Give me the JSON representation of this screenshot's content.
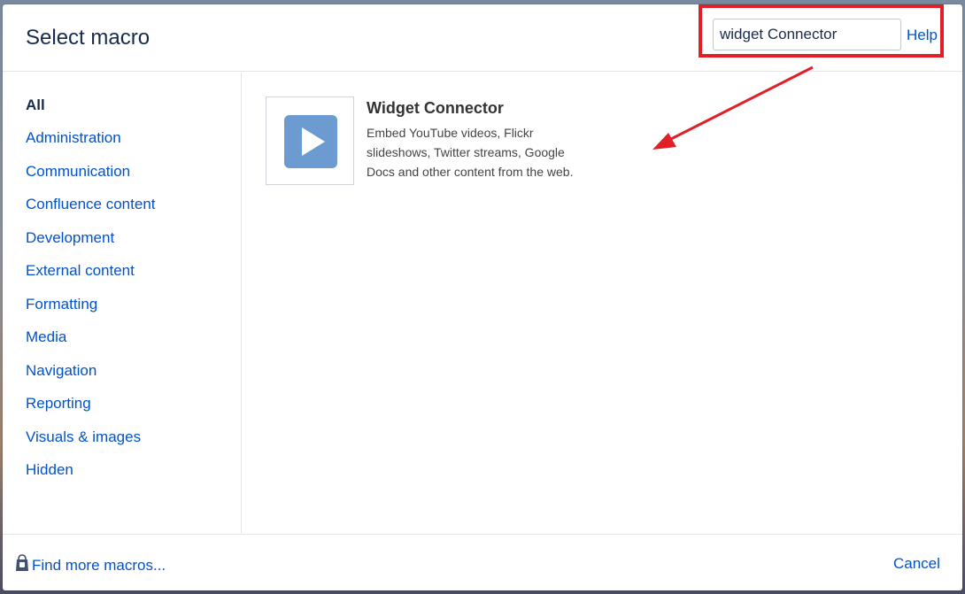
{
  "dialog": {
    "title": "Select macro",
    "search": {
      "value": "widget Connector",
      "placeholder": "Search"
    },
    "help_label": "Help"
  },
  "sidebar": {
    "items": [
      {
        "label": "All",
        "active": true
      },
      {
        "label": "Administration"
      },
      {
        "label": "Communication"
      },
      {
        "label": "Confluence content"
      },
      {
        "label": "Development"
      },
      {
        "label": "External content"
      },
      {
        "label": "Formatting"
      },
      {
        "label": "Media"
      },
      {
        "label": "Navigation"
      },
      {
        "label": "Reporting"
      },
      {
        "label": "Visuals & images"
      },
      {
        "label": "Hidden"
      }
    ]
  },
  "results": [
    {
      "title": "Widget Connector",
      "description": "Embed YouTube videos, Flickr slideshows, Twitter streams, Google Docs and other content from the web.",
      "icon": "play-icon"
    }
  ],
  "footer": {
    "find_more_label": "Find more macros...",
    "find_more_icon": "marketplace-bag-icon",
    "cancel_label": "Cancel"
  },
  "colors": {
    "link": "#0052cc",
    "heading": "#172b4d",
    "highlight": "#e01f26",
    "play_tile": "#6b9bd1"
  }
}
